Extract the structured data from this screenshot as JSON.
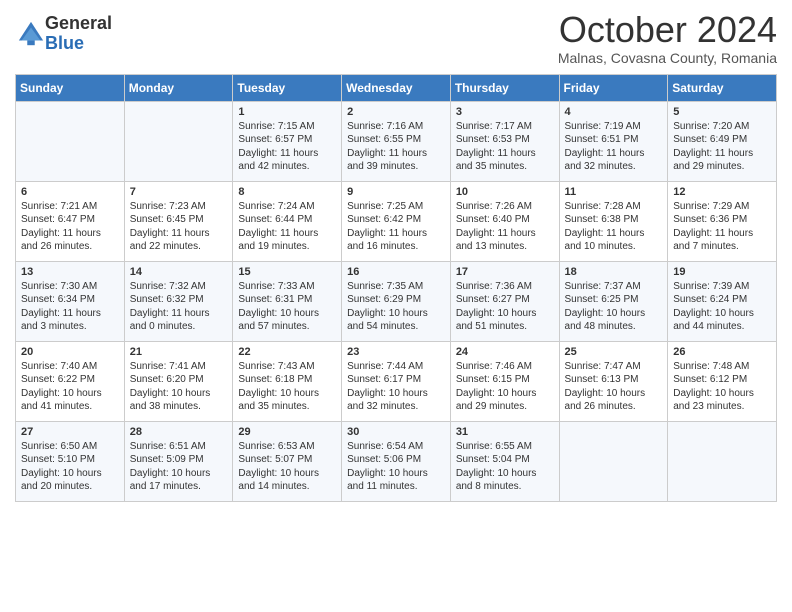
{
  "logo": {
    "general": "General",
    "blue": "Blue"
  },
  "header": {
    "month": "October 2024",
    "subtitle": "Malnas, Covasna County, Romania"
  },
  "days_of_week": [
    "Sunday",
    "Monday",
    "Tuesday",
    "Wednesday",
    "Thursday",
    "Friday",
    "Saturday"
  ],
  "weeks": [
    [
      {
        "day": "",
        "content": ""
      },
      {
        "day": "",
        "content": ""
      },
      {
        "day": "1",
        "content": "Sunrise: 7:15 AM\nSunset: 6:57 PM\nDaylight: 11 hours and 42 minutes."
      },
      {
        "day": "2",
        "content": "Sunrise: 7:16 AM\nSunset: 6:55 PM\nDaylight: 11 hours and 39 minutes."
      },
      {
        "day": "3",
        "content": "Sunrise: 7:17 AM\nSunset: 6:53 PM\nDaylight: 11 hours and 35 minutes."
      },
      {
        "day": "4",
        "content": "Sunrise: 7:19 AM\nSunset: 6:51 PM\nDaylight: 11 hours and 32 minutes."
      },
      {
        "day": "5",
        "content": "Sunrise: 7:20 AM\nSunset: 6:49 PM\nDaylight: 11 hours and 29 minutes."
      }
    ],
    [
      {
        "day": "6",
        "content": "Sunrise: 7:21 AM\nSunset: 6:47 PM\nDaylight: 11 hours and 26 minutes."
      },
      {
        "day": "7",
        "content": "Sunrise: 7:23 AM\nSunset: 6:45 PM\nDaylight: 11 hours and 22 minutes."
      },
      {
        "day": "8",
        "content": "Sunrise: 7:24 AM\nSunset: 6:44 PM\nDaylight: 11 hours and 19 minutes."
      },
      {
        "day": "9",
        "content": "Sunrise: 7:25 AM\nSunset: 6:42 PM\nDaylight: 11 hours and 16 minutes."
      },
      {
        "day": "10",
        "content": "Sunrise: 7:26 AM\nSunset: 6:40 PM\nDaylight: 11 hours and 13 minutes."
      },
      {
        "day": "11",
        "content": "Sunrise: 7:28 AM\nSunset: 6:38 PM\nDaylight: 11 hours and 10 minutes."
      },
      {
        "day": "12",
        "content": "Sunrise: 7:29 AM\nSunset: 6:36 PM\nDaylight: 11 hours and 7 minutes."
      }
    ],
    [
      {
        "day": "13",
        "content": "Sunrise: 7:30 AM\nSunset: 6:34 PM\nDaylight: 11 hours and 3 minutes."
      },
      {
        "day": "14",
        "content": "Sunrise: 7:32 AM\nSunset: 6:32 PM\nDaylight: 11 hours and 0 minutes."
      },
      {
        "day": "15",
        "content": "Sunrise: 7:33 AM\nSunset: 6:31 PM\nDaylight: 10 hours and 57 minutes."
      },
      {
        "day": "16",
        "content": "Sunrise: 7:35 AM\nSunset: 6:29 PM\nDaylight: 10 hours and 54 minutes."
      },
      {
        "day": "17",
        "content": "Sunrise: 7:36 AM\nSunset: 6:27 PM\nDaylight: 10 hours and 51 minutes."
      },
      {
        "day": "18",
        "content": "Sunrise: 7:37 AM\nSunset: 6:25 PM\nDaylight: 10 hours and 48 minutes."
      },
      {
        "day": "19",
        "content": "Sunrise: 7:39 AM\nSunset: 6:24 PM\nDaylight: 10 hours and 44 minutes."
      }
    ],
    [
      {
        "day": "20",
        "content": "Sunrise: 7:40 AM\nSunset: 6:22 PM\nDaylight: 10 hours and 41 minutes."
      },
      {
        "day": "21",
        "content": "Sunrise: 7:41 AM\nSunset: 6:20 PM\nDaylight: 10 hours and 38 minutes."
      },
      {
        "day": "22",
        "content": "Sunrise: 7:43 AM\nSunset: 6:18 PM\nDaylight: 10 hours and 35 minutes."
      },
      {
        "day": "23",
        "content": "Sunrise: 7:44 AM\nSunset: 6:17 PM\nDaylight: 10 hours and 32 minutes."
      },
      {
        "day": "24",
        "content": "Sunrise: 7:46 AM\nSunset: 6:15 PM\nDaylight: 10 hours and 29 minutes."
      },
      {
        "day": "25",
        "content": "Sunrise: 7:47 AM\nSunset: 6:13 PM\nDaylight: 10 hours and 26 minutes."
      },
      {
        "day": "26",
        "content": "Sunrise: 7:48 AM\nSunset: 6:12 PM\nDaylight: 10 hours and 23 minutes."
      }
    ],
    [
      {
        "day": "27",
        "content": "Sunrise: 6:50 AM\nSunset: 5:10 PM\nDaylight: 10 hours and 20 minutes."
      },
      {
        "day": "28",
        "content": "Sunrise: 6:51 AM\nSunset: 5:09 PM\nDaylight: 10 hours and 17 minutes."
      },
      {
        "day": "29",
        "content": "Sunrise: 6:53 AM\nSunset: 5:07 PM\nDaylight: 10 hours and 14 minutes."
      },
      {
        "day": "30",
        "content": "Sunrise: 6:54 AM\nSunset: 5:06 PM\nDaylight: 10 hours and 11 minutes."
      },
      {
        "day": "31",
        "content": "Sunrise: 6:55 AM\nSunset: 5:04 PM\nDaylight: 10 hours and 8 minutes."
      },
      {
        "day": "",
        "content": ""
      },
      {
        "day": "",
        "content": ""
      }
    ]
  ]
}
